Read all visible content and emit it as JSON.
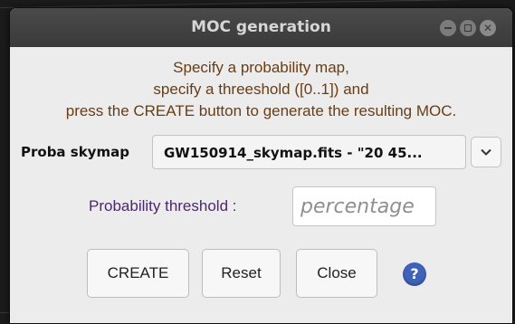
{
  "window": {
    "title": "MOC generation"
  },
  "instructions": {
    "line1": "Specify a probability map,",
    "line2": "specify a threeshold ([0..1]) and",
    "line3": "press the CREATE button to generate the resulting MOC."
  },
  "proba": {
    "label": "Proba skymap",
    "selected": "GW150914_skymap.fits - \"20 45..."
  },
  "threshold": {
    "label": "Probability threshold :",
    "placeholder": "percentage",
    "value": ""
  },
  "buttons": {
    "create": "CREATE",
    "reset": "Reset",
    "close": "Close",
    "help": "?"
  },
  "icons": {
    "minimize": "minimize-icon",
    "maximize": "maximize-icon",
    "close": "close-icon",
    "dropdown": "chevron-down-icon",
    "help": "help-icon"
  },
  "colors": {
    "instructions_text": "#6a3d12",
    "threshold_label": "#4a2a6a",
    "help_icon": "#3f63b8",
    "titlebar": "#3d3d3d"
  }
}
